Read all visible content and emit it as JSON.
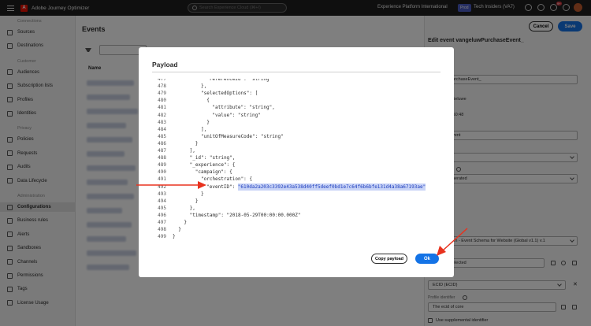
{
  "topbar": {
    "app_title": "Adobe Journey Optimizer",
    "search_placeholder": "Search Experience Cloud (⌘+/)",
    "org": "Experience Platform International",
    "env_badge": "Prod",
    "sandbox": "Tech Insiders (VA7)",
    "notifications_count": "9+"
  },
  "sidebar": {
    "sections": [
      {
        "header": "Connections",
        "items": [
          "Sources",
          "Destinations"
        ]
      },
      {
        "header": "Customer",
        "items": [
          "Audiences",
          "Subscription lists",
          "Profiles",
          "Identities"
        ]
      },
      {
        "header": "Privacy",
        "items": [
          "Policies",
          "Requests",
          "Audits",
          "Data Lifecycle"
        ]
      },
      {
        "header": "Administration",
        "items": [
          "Configurations",
          "Business rules",
          "Alerts",
          "Sandboxes",
          "Channels",
          "Permissions",
          "Tags",
          "License Usage"
        ]
      }
    ],
    "active_item": "Configurations"
  },
  "main": {
    "title": "Events",
    "table_header_name": "Name"
  },
  "panel": {
    "cancel_label": "Cancel",
    "save_label": "Save",
    "title": "Edit event vangeluwPurchaseEvent_",
    "name_value": "urchaseEvent_",
    "created_by": "Geluwe",
    "created_time": ":50:48",
    "type_value": "vent",
    "id_type_value": "nerated",
    "schema_value": "rm - Event Schema for Website (Global v1.1) v.1",
    "fields_value": "elected",
    "namespace_label": "Namespace",
    "namespace_value": "ECID (ECID)",
    "profile_identifier_label": "Profile identifier",
    "profile_identifier_value": "The ecid of core",
    "supplemental_label": "Use supplemental identifier"
  },
  "modal": {
    "title": "Payload",
    "copy_label": "Copy payload",
    "ok_label": "Ok",
    "code_lines": [
      {
        "n": "477",
        "indent": 12,
        "code": "\"referenceId\": \"string\""
      },
      {
        "n": "478",
        "indent": 10,
        "code": "},"
      },
      {
        "n": "479",
        "indent": 10,
        "code": "\"selectedOptions\": ["
      },
      {
        "n": "480",
        "indent": 12,
        "code": "{"
      },
      {
        "n": "481",
        "indent": 14,
        "code": "\"attribute\": \"string\","
      },
      {
        "n": "482",
        "indent": 14,
        "code": "\"value\": \"string\""
      },
      {
        "n": "483",
        "indent": 12,
        "code": "}"
      },
      {
        "n": "484",
        "indent": 10,
        "code": "],"
      },
      {
        "n": "485",
        "indent": 10,
        "code": "\"unitOfMeasureCode\": \"string\""
      },
      {
        "n": "486",
        "indent": 8,
        "code": "}"
      },
      {
        "n": "487",
        "indent": 6,
        "code": "],"
      },
      {
        "n": "488",
        "indent": 6,
        "code": "\"_id\": \"string\","
      },
      {
        "n": "489",
        "indent": 6,
        "code": "\"_experience\": {"
      },
      {
        "n": "490",
        "indent": 8,
        "code": "\"campaign\": {"
      },
      {
        "n": "491",
        "indent": 10,
        "code": "\"orchestration\": {"
      },
      {
        "n": "492",
        "indent": 12,
        "code": "\"eventID\": ",
        "highlight": "\"610da2a203c3392e43a538d40ff5deef0bd1e7c64f6b6bfe131d4a38a67193ae\""
      },
      {
        "n": "493",
        "indent": 10,
        "code": "}"
      },
      {
        "n": "494",
        "indent": 8,
        "code": "}"
      },
      {
        "n": "495",
        "indent": 6,
        "code": "},"
      },
      {
        "n": "496",
        "indent": 6,
        "code": "\"timestamp\": \"2018-05-29T00:00:00.000Z\""
      },
      {
        "n": "497",
        "indent": 4,
        "code": "}"
      },
      {
        "n": "498",
        "indent": 2,
        "code": "}"
      },
      {
        "n": "499",
        "indent": 0,
        "code": "}"
      }
    ]
  },
  "colors": {
    "accent": "#1473e6",
    "arrow": "#e8321e",
    "highlight": "#c9d4f7",
    "code_string": "#1c3dbd"
  }
}
